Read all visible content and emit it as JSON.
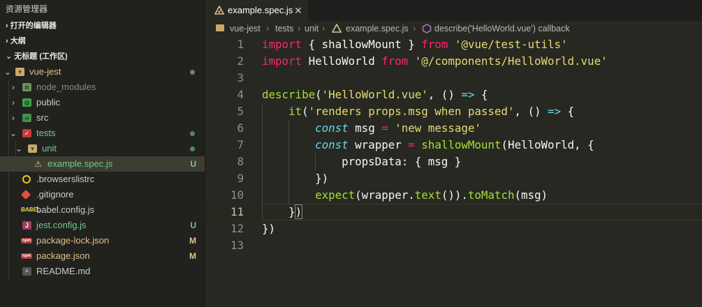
{
  "sidebar": {
    "title": "资源管理器",
    "sections": {
      "open_editors": "打开的编辑器",
      "outline": "大纲",
      "workspace": "无标题 (工作区)"
    },
    "items": [
      {
        "label": "vue-jest",
        "type": "folder",
        "color": "#e2c08d",
        "status": "dot"
      },
      {
        "label": "node_modules",
        "type": "folder",
        "color": "#8c8c8c"
      },
      {
        "label": "public",
        "type": "folder",
        "color": "#cccccc"
      },
      {
        "label": "src",
        "type": "folder",
        "color": "#cccccc"
      },
      {
        "label": "tests",
        "type": "folder",
        "color": "#73c991",
        "status": "dot"
      },
      {
        "label": "unit",
        "type": "folder",
        "color": "#73c991",
        "status": "dot"
      },
      {
        "label": "example.spec.js",
        "type": "file",
        "color": "#73c991",
        "badge": "U"
      },
      {
        "label": ".browserslistrc",
        "type": "file",
        "color": "#cccccc"
      },
      {
        "label": ".gitignore",
        "type": "file",
        "color": "#cccccc"
      },
      {
        "label": "babel.config.js",
        "type": "file",
        "color": "#cccccc"
      },
      {
        "label": "jest.config.js",
        "type": "file",
        "color": "#73c991",
        "badge": "U"
      },
      {
        "label": "package-lock.json",
        "type": "file",
        "color": "#e2c08d",
        "badge": "M"
      },
      {
        "label": "package.json",
        "type": "file",
        "color": "#e2c08d",
        "badge": "M"
      },
      {
        "label": "README.md",
        "type": "file",
        "color": "#cccccc"
      }
    ]
  },
  "tab": {
    "label": "example.spec.js",
    "close": "✕"
  },
  "breadcrumb": [
    "vue-jest",
    "tests",
    "unit",
    "example.spec.js",
    "describe('HelloWorld.vue') callback"
  ],
  "code": {
    "line_numbers": [
      "1",
      "2",
      "3",
      "4",
      "5",
      "6",
      "7",
      "8",
      "9",
      "10",
      "11",
      "12",
      "13"
    ],
    "current_line": "11",
    "lines": [
      [
        [
          "kw",
          "import"
        ],
        [
          "",
          "{ shallowMount } "
        ],
        [
          "kw",
          "from"
        ],
        [
          "",
          ""
        ],
        [
          "st",
          "'@vue/test-utils'"
        ]
      ],
      [
        [
          "kw",
          "import"
        ],
        [
          "",
          "HelloWorld "
        ],
        [
          "kw",
          "from"
        ],
        [
          "",
          ""
        ],
        [
          "st",
          "'@/components/HelloWorld.vue'"
        ]
      ],
      [],
      [
        [
          "fn",
          "describe"
        ],
        [
          "",
          "("
        ],
        [
          "st",
          "'HelloWorld.vue'"
        ],
        [
          "",
          ", () "
        ],
        [
          "sk",
          "=>"
        ],
        [
          "",
          " {"
        ]
      ],
      [
        [
          "",
          "    "
        ],
        [
          "fn",
          "it"
        ],
        [
          "",
          "("
        ],
        [
          "st",
          "'renders props.msg when passed'"
        ],
        [
          "",
          ", () "
        ],
        [
          "sk",
          "=>"
        ],
        [
          "",
          " {"
        ]
      ],
      [
        [
          "",
          "        "
        ],
        [
          "sk",
          "const"
        ],
        [
          "",
          " msg "
        ],
        [
          "kw",
          "="
        ],
        [
          "",
          " "
        ],
        [
          "st",
          "'new message'"
        ]
      ],
      [
        [
          "",
          "        "
        ],
        [
          "sk",
          "const"
        ],
        [
          "",
          " wrapper "
        ],
        [
          "kw",
          "="
        ],
        [
          "",
          " "
        ],
        [
          "fn",
          "shallowMount"
        ],
        [
          "",
          "(HelloWorld, {"
        ]
      ],
      [
        [
          "",
          "            propsData: { msg }"
        ]
      ],
      [
        [
          "",
          "        })"
        ]
      ],
      [
        [
          "",
          "        "
        ],
        [
          "fn",
          "expect"
        ],
        [
          "",
          "(wrapper."
        ],
        [
          "fn",
          "text"
        ],
        [
          "",
          "())."
        ],
        [
          "fn",
          "toMatch"
        ],
        [
          "",
          "(msg)"
        ]
      ],
      [
        [
          "",
          "    })"
        ]
      ],
      [
        [
          "",
          "})"
        ]
      ],
      []
    ]
  }
}
